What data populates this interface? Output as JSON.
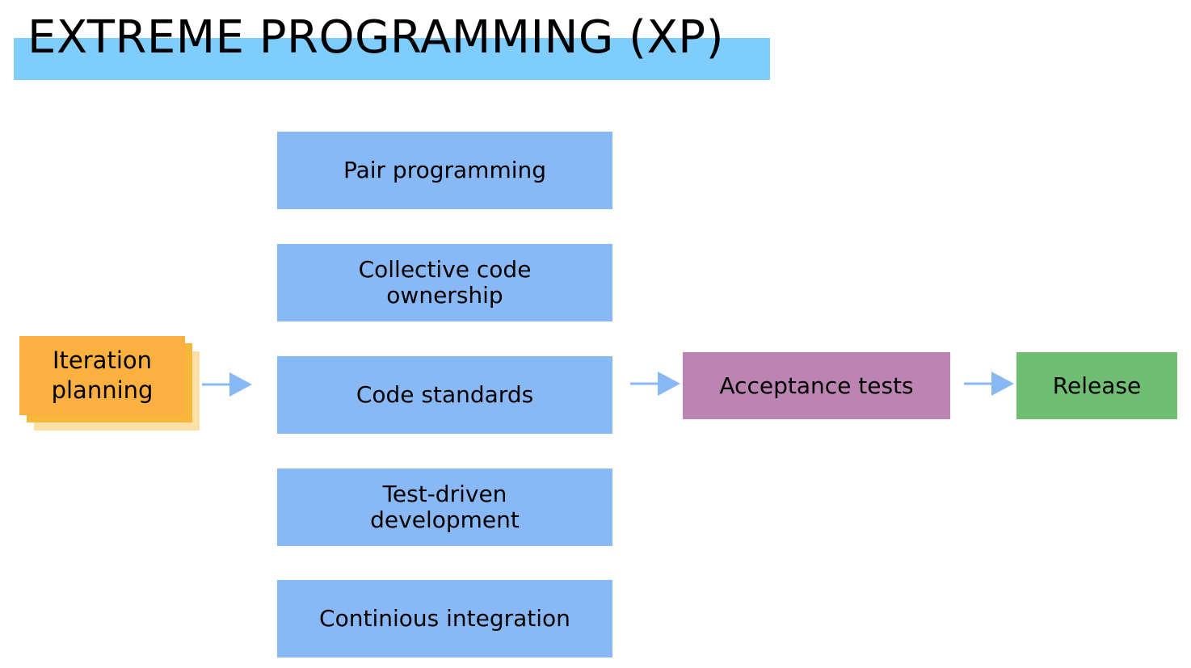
{
  "title": "EXTREME PROGRAMMING (XP)",
  "planning": {
    "label": "Iteration planning"
  },
  "practices": [
    "Pair programming",
    "Collective code ownership",
    "Code standards",
    "Test-driven development",
    "Continious integration"
  ],
  "acceptance": {
    "label": "Acceptance tests"
  },
  "release": {
    "label": "Release"
  },
  "colors": {
    "title_highlight": "#7fcdfd",
    "planning": "#fbb040",
    "practice": "#88b9f4",
    "acceptance": "#bc84b2",
    "release": "#70be72",
    "arrow": "#88b9f4"
  }
}
